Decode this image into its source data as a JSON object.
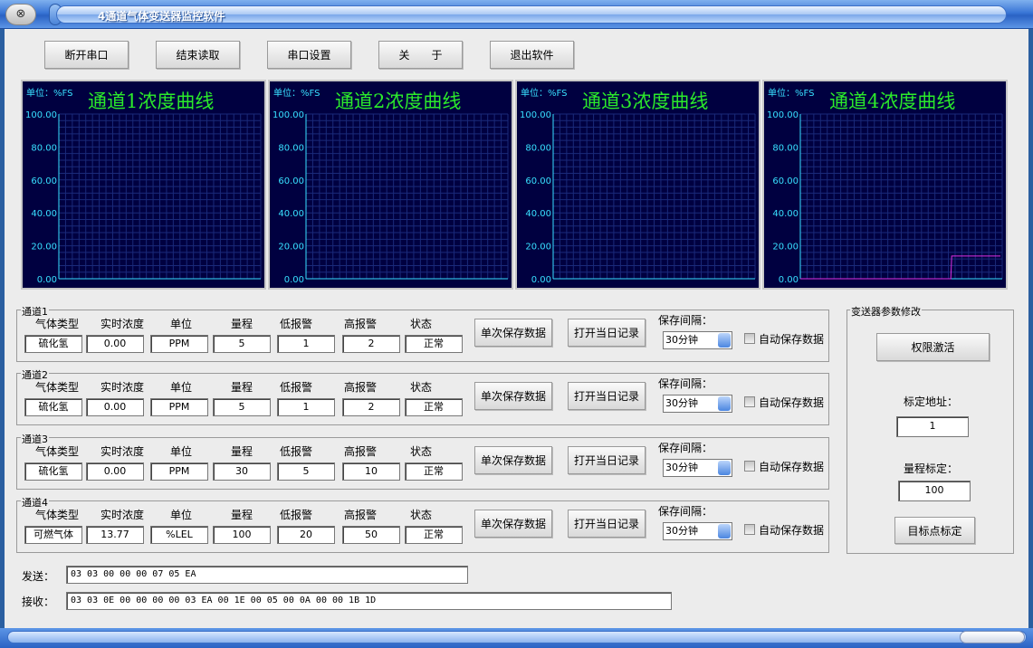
{
  "window": {
    "title": "4通道气体变送器监控软件"
  },
  "toolbar": {
    "disconnect": "断开串口",
    "stop_read": "结束读取",
    "port_settings": "串口设置",
    "about": "关　　于",
    "exit": "退出软件"
  },
  "charts": [
    {
      "title": "通道1浓度曲线",
      "unit": "单位：%FS"
    },
    {
      "title": "通道2浓度曲线",
      "unit": "单位：%FS"
    },
    {
      "title": "通道3浓度曲线",
      "unit": "单位：%FS"
    },
    {
      "title": "通道4浓度曲线",
      "unit": "单位：%FS"
    }
  ],
  "chart_data": [
    {
      "type": "line",
      "title": "通道1浓度曲线",
      "ylabel": "单位：%FS",
      "ylim": [
        0,
        100
      ],
      "yticks": [
        "100.00",
        "80.00",
        "60.00",
        "40.00",
        "20.00",
        "0.00"
      ],
      "grid": true,
      "series": [
        {
          "values": []
        }
      ]
    },
    {
      "type": "line",
      "title": "通道2浓度曲线",
      "ylabel": "单位：%FS",
      "ylim": [
        0,
        100
      ],
      "yticks": [
        "100.00",
        "80.00",
        "60.00",
        "40.00",
        "20.00",
        "0.00"
      ],
      "grid": true,
      "series": [
        {
          "values": []
        }
      ]
    },
    {
      "type": "line",
      "title": "通道3浓度曲线",
      "ylabel": "单位：%FS",
      "ylim": [
        0,
        100
      ],
      "yticks": [
        "100.00",
        "80.00",
        "60.00",
        "40.00",
        "20.00",
        "0.00"
      ],
      "grid": true,
      "series": [
        {
          "values": []
        }
      ]
    },
    {
      "type": "line",
      "title": "通道4浓度曲线",
      "ylabel": "单位：%FS",
      "ylim": [
        0,
        100
      ],
      "yticks": [
        "100.00",
        "80.00",
        "60.00",
        "40.00",
        "20.00",
        "0.00"
      ],
      "grid": true,
      "series": [
        {
          "values": [
            0,
            0,
            0,
            0,
            0,
            0,
            0,
            0,
            0,
            0,
            0,
            0,
            0,
            0,
            0,
            0,
            0,
            0,
            0,
            0,
            0,
            0,
            0,
            0,
            0,
            0,
            0,
            0,
            0,
            0,
            0,
            0,
            0,
            0,
            0,
            0,
            0,
            0,
            0,
            0,
            0,
            0,
            0,
            0,
            0,
            0,
            0,
            0,
            0,
            0,
            0,
            0,
            0,
            0,
            0,
            0,
            0,
            0,
            0,
            0,
            0,
            0,
            0,
            0,
            0,
            0,
            0,
            0,
            0,
            0,
            0,
            0,
            0,
            0,
            0,
            0,
            0,
            0,
            0,
            0,
            0,
            0,
            0,
            0,
            0,
            0,
            0,
            0,
            0,
            0,
            0,
            0,
            0,
            0,
            0,
            0,
            0,
            0,
            0,
            0,
            0,
            0,
            0,
            0,
            0,
            0,
            0,
            0,
            0,
            0,
            0,
            0,
            0,
            0,
            0,
            0,
            0,
            0,
            0,
            0,
            0,
            0,
            0,
            0,
            0,
            0,
            0,
            0,
            0,
            0,
            0,
            0,
            0,
            0,
            0,
            0,
            0,
            0,
            0,
            0,
            0,
            0,
            0,
            0,
            0,
            0,
            0,
            0,
            0,
            0,
            0,
            0,
            0,
            0,
            0,
            0,
            0,
            0,
            0,
            0,
            0,
            0,
            0,
            0,
            0,
            0,
            0,
            0,
            13.77,
            13.77,
            13.77,
            13.77,
            13.77,
            13.77,
            13.77,
            13.77,
            13.77,
            13.77,
            13.77,
            13.77,
            13.77,
            13.77,
            13.77,
            13.77,
            13.77,
            13.77,
            13.77,
            13.77,
            13.77,
            13.77,
            13.77,
            13.77,
            13.77,
            13.77,
            13.77,
            13.77,
            13.77,
            13.77,
            13.77,
            13.77,
            13.77,
            13.77,
            13.77,
            13.77,
            13.77,
            13.77,
            13.77,
            13.77,
            13.77,
            13.77,
            13.77,
            13.77,
            13.77,
            13.77,
            13.77,
            13.77,
            13.77,
            13.77,
            13.77,
            13.77,
            13.77,
            13.77,
            13.77
          ]
        }
      ]
    }
  ],
  "headers": {
    "gas_type": "气体类型",
    "realtime": "实时浓度",
    "unit": "单位",
    "range": "量程",
    "low_alarm": "低报警",
    "high_alarm": "高报警",
    "status": "状态",
    "save_interval": "保存间隔："
  },
  "channels": [
    {
      "label": "通道1",
      "gas": "硫化氢",
      "conc": "0.00",
      "unit": "PPM",
      "range": "5",
      "low": "1",
      "high": "2",
      "status": "正常",
      "save_once": "单次保存数据",
      "open_today": "打开当日记录",
      "interval": "30分钟",
      "auto_save": "自动保存数据"
    },
    {
      "label": "通道2",
      "gas": "硫化氢",
      "conc": "0.00",
      "unit": "PPM",
      "range": "5",
      "low": "1",
      "high": "2",
      "status": "正常",
      "save_once": "单次保存数据",
      "open_today": "打开当日记录",
      "interval": "30分钟",
      "auto_save": "自动保存数据"
    },
    {
      "label": "通道3",
      "gas": "硫化氢",
      "conc": "0.00",
      "unit": "PPM",
      "range": "30",
      "low": "5",
      "high": "10",
      "status": "正常",
      "save_once": "单次保存数据",
      "open_today": "打开当日记录",
      "interval": "30分钟",
      "auto_save": "自动保存数据"
    },
    {
      "label": "通道4",
      "gas": "可燃气体",
      "conc": "13.77",
      "unit": "%LEL",
      "range": "100",
      "low": "20",
      "high": "50",
      "status": "正常",
      "save_once": "单次保存数据",
      "open_today": "打开当日记录",
      "interval": "30分钟",
      "auto_save": "自动保存数据"
    }
  ],
  "params": {
    "title": "变送器参数修改",
    "activate": "权限激活",
    "addr_label": "标定地址：",
    "addr_value": "1",
    "range_label": "量程标定：",
    "range_value": "100",
    "calibrate": "目标点标定"
  },
  "comm": {
    "send_label": "发送：",
    "send_value": "03 03 00 00 00 07 05 EA",
    "recv_label": "接收：",
    "recv_value": "03 03 0E 00 00 00 00 03 EA 00 1E 00 05 00 0A 00 00 1B 1D"
  },
  "colors": {
    "chart_bg": "#000040",
    "grid": "#1a2a7a",
    "axis": "#38e0ff",
    "title": "#2bea2b",
    "trace": "#e030e0"
  }
}
